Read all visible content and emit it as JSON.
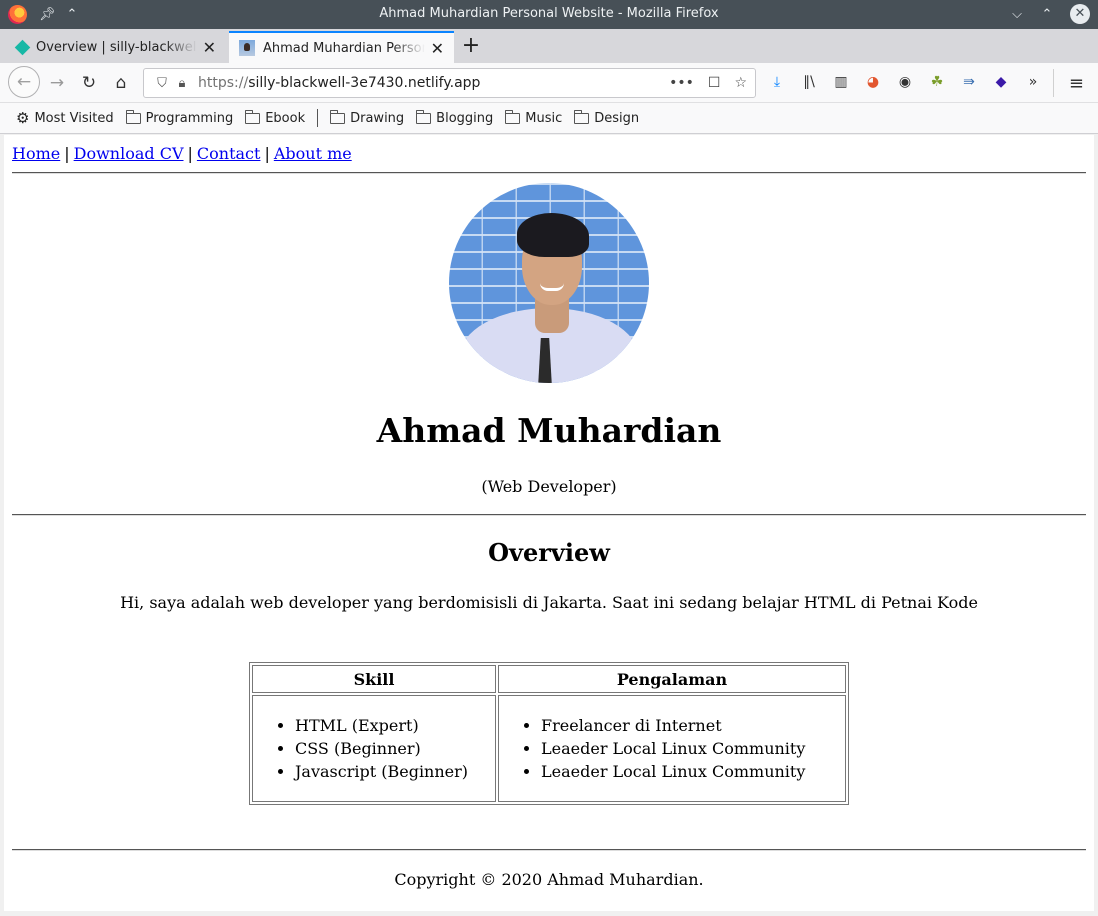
{
  "window": {
    "title": "Ahmad Muhardian Personal Website - Mozilla Firefox"
  },
  "tabs": [
    {
      "label": "Overview | silly-blackwell-3e7430",
      "favicon": "netlify-diamond-icon",
      "active": false
    },
    {
      "label": "Ahmad Muhardian Personal Website",
      "favicon": "photo-favicon",
      "active": true
    }
  ],
  "navigation": {
    "url_scheme": "https://",
    "url_host": "silly-blackwell-3e7430.netlify.app"
  },
  "bookmarks": [
    {
      "label": "Most Visited",
      "icon": "gear-icon"
    },
    {
      "label": "Programming",
      "icon": "folder-icon"
    },
    {
      "label": "Ebook",
      "icon": "folder-icon"
    },
    {
      "label": "Drawing",
      "icon": "folder-icon"
    },
    {
      "label": "Blogging",
      "icon": "folder-icon"
    },
    {
      "label": "Music",
      "icon": "folder-icon"
    },
    {
      "label": "Design",
      "icon": "folder-icon"
    }
  ],
  "site": {
    "nav": [
      "Home",
      "Download CV",
      "Contact",
      "About me"
    ],
    "nav_separator": "|",
    "name": "Ahmad Muhardian",
    "role": "(Web Developer)",
    "section_title": "Overview",
    "intro": "Hi, saya adalah web developer yang berdomisisli di Jakarta. Saat ini sedang belajar HTML di Petnai Kode",
    "table": {
      "headers": [
        "Skill",
        "Pengalaman"
      ],
      "skills": [
        "HTML (Expert)",
        "CSS (Beginner)",
        "Javascript (Beginner)"
      ],
      "experience": [
        "Freelancer di Internet",
        "Leaeder Local Linux Community",
        "Leaeder Local Linux Community"
      ]
    },
    "copyright": "Copyright © 2020 Ahmad Muhardian."
  },
  "colors": {
    "link": "#0000ee",
    "titlebar": "#475057",
    "active_tab_accent": "#0a84ff"
  }
}
